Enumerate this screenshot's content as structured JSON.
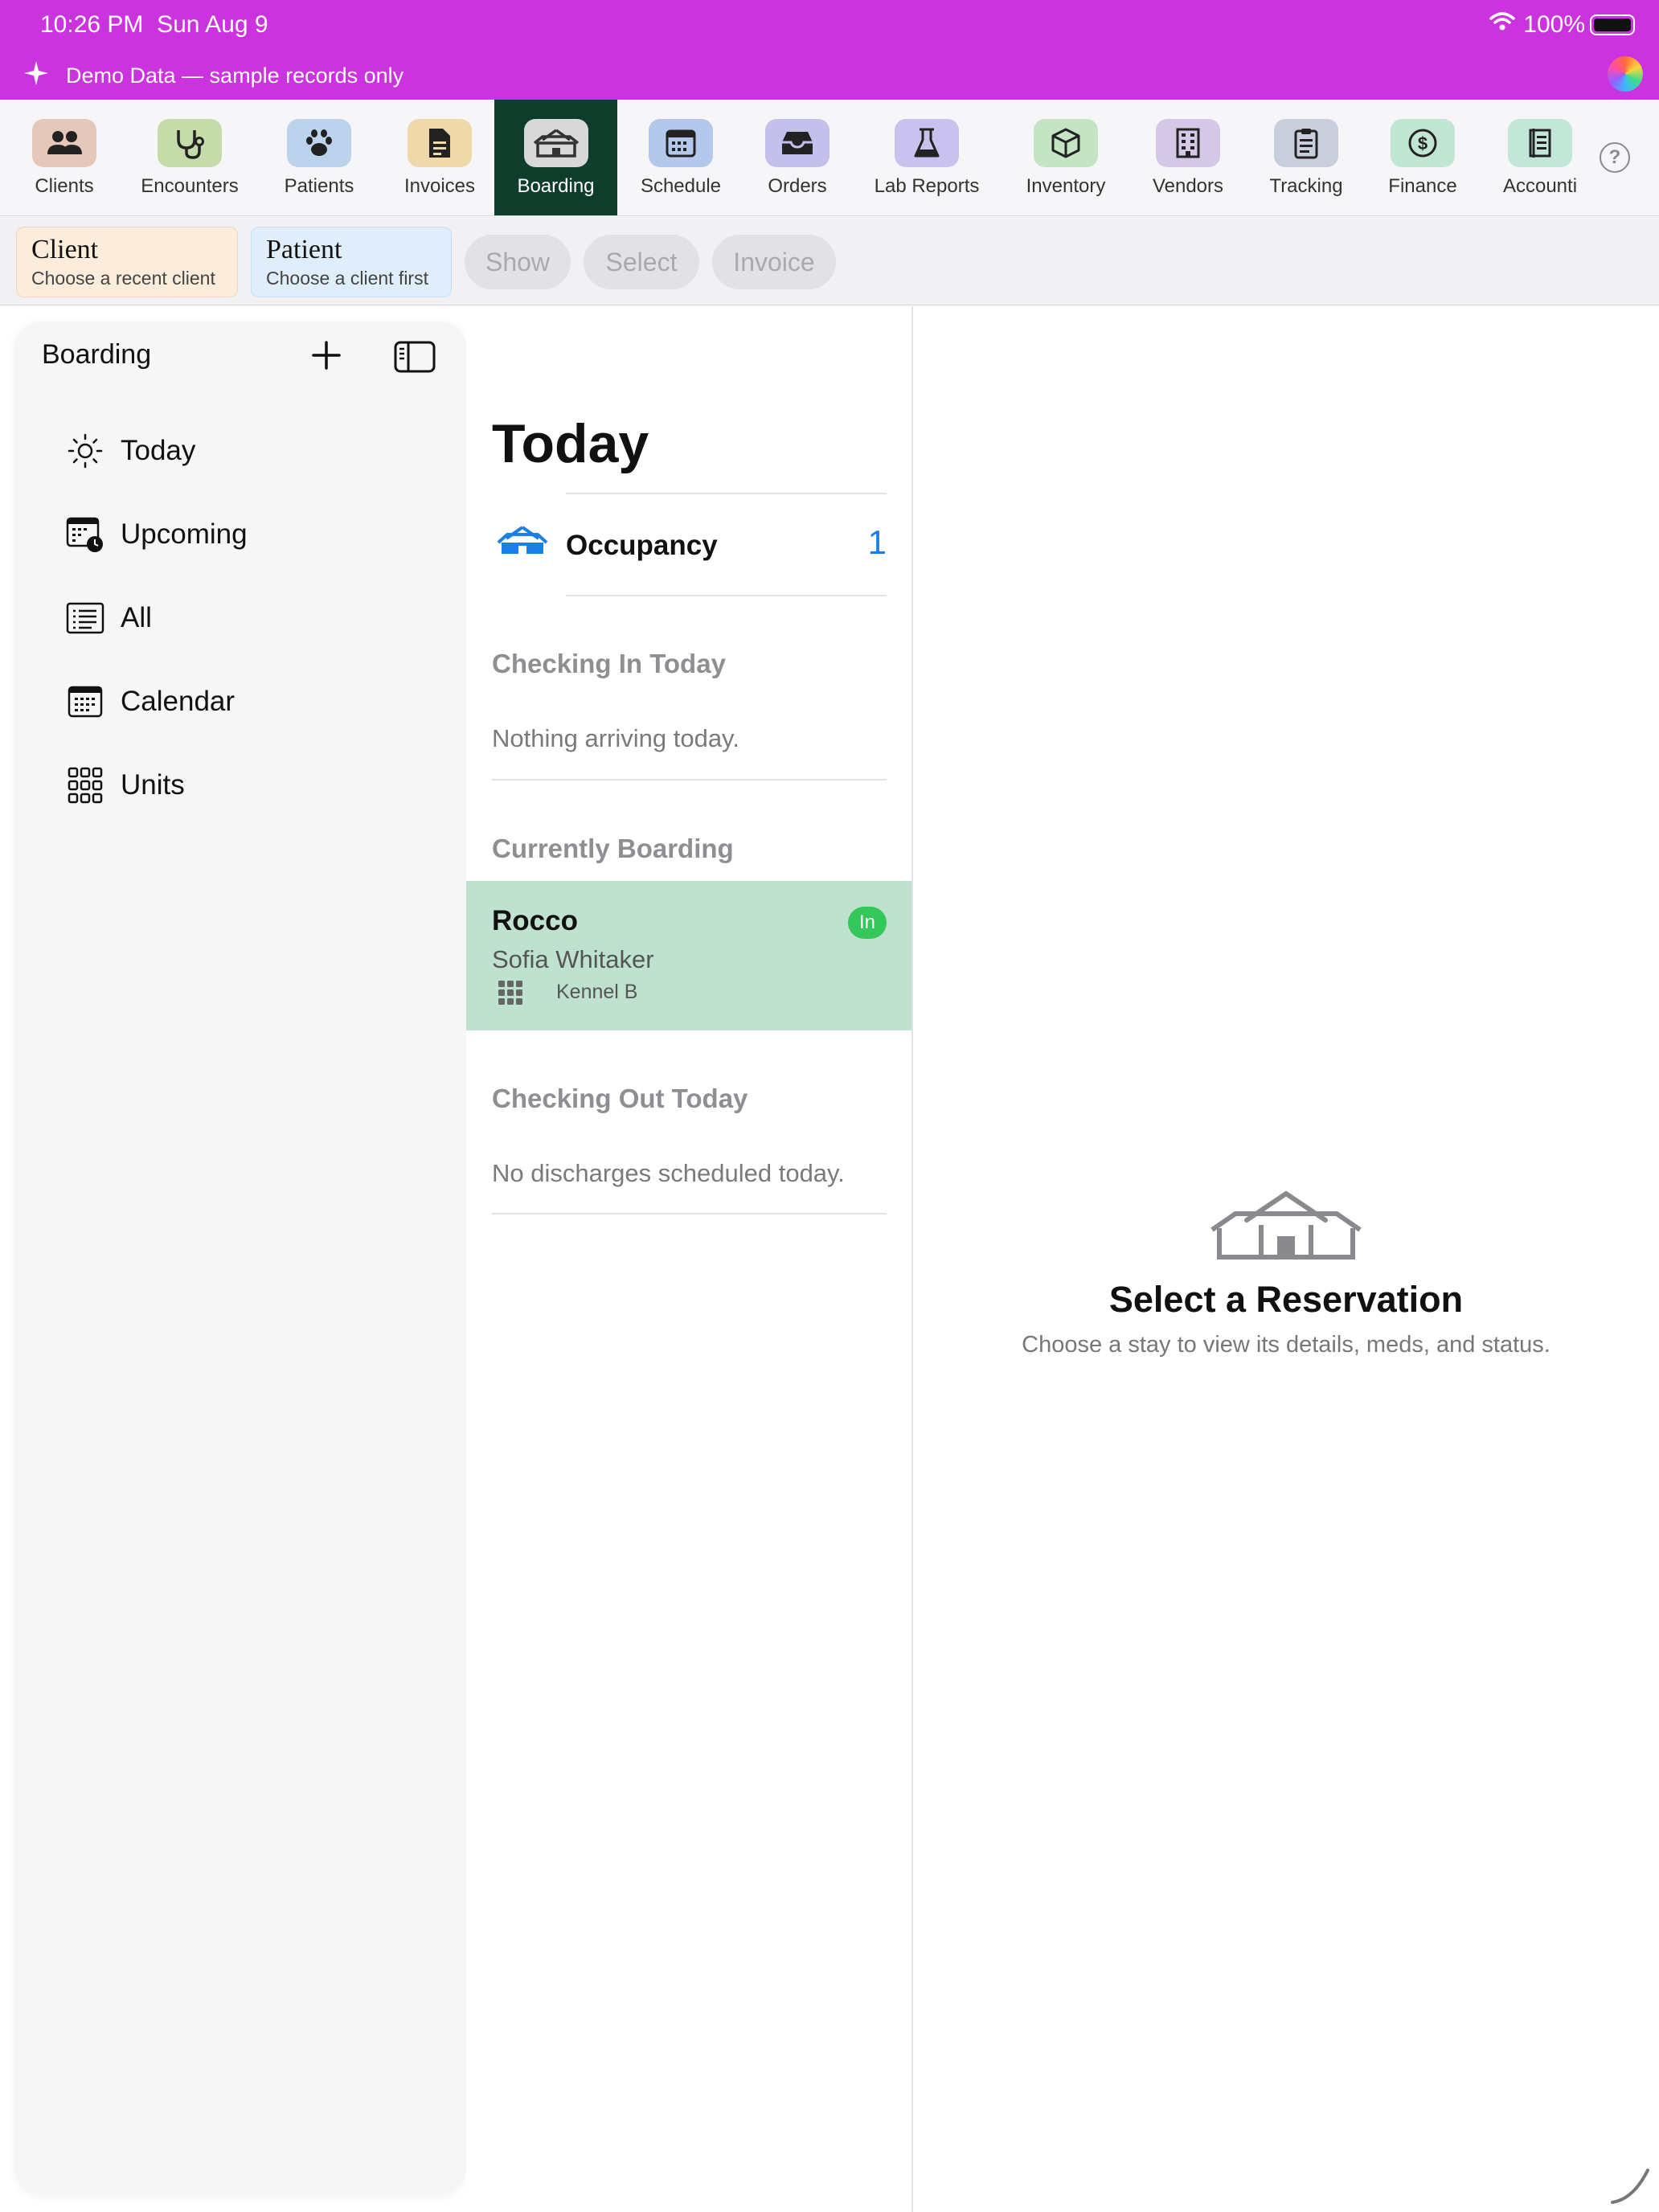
{
  "status_bar": {
    "time": "10:26 PM",
    "date": "Sun Aug 9",
    "battery": "100%",
    "banner": "Demo Data — sample records only",
    "bg_color": "#cb33de"
  },
  "toolbar": {
    "items": [
      {
        "label": "Clients",
        "icon": "people-icon",
        "color": "#e6c8ba"
      },
      {
        "label": "Encounters",
        "icon": "stethoscope-icon",
        "color": "#c5dcaa"
      },
      {
        "label": "Patients",
        "icon": "paw-icon",
        "color": "#bcd3ee"
      },
      {
        "label": "Invoices",
        "icon": "document-icon",
        "color": "#efd9aa"
      },
      {
        "label": "Boarding",
        "icon": "boarding-house-icon",
        "color": "#d8d8d8",
        "active": true
      },
      {
        "label": "Schedule",
        "icon": "calendar-icon",
        "color": "#b4c8ec"
      },
      {
        "label": "Orders",
        "icon": "tray-icon",
        "color": "#c4c0ec"
      },
      {
        "label": "Lab Reports",
        "icon": "flask-icon",
        "color": "#cac2ee"
      },
      {
        "label": "Inventory",
        "icon": "box-icon",
        "color": "#c4e4c4"
      },
      {
        "label": "Vendors",
        "icon": "building-icon",
        "color": "#d4c8e6"
      },
      {
        "label": "Tracking",
        "icon": "clipboard-icon",
        "color": "#c8cedc"
      },
      {
        "label": "Finance",
        "icon": "dollar-icon",
        "color": "#c2e6d4"
      },
      {
        "label": "Accounti",
        "icon": "ledger-icon",
        "color": "#c2e6d8"
      }
    ],
    "active_color": "#0f3d2b",
    "help": "?"
  },
  "context_bar": {
    "client": {
      "title": "Client",
      "subtitle": "Choose a recent client",
      "color": "#fbecdb"
    },
    "patient": {
      "title": "Patient",
      "subtitle": "Choose a client first",
      "color": "#dfeefa"
    },
    "pills": [
      "Show",
      "Select",
      "Invoice"
    ]
  },
  "sidebar": {
    "title": "Boarding",
    "items": [
      {
        "label": "Today",
        "icon": "sun-icon"
      },
      {
        "label": "Upcoming",
        "icon": "calendar-clock-icon"
      },
      {
        "label": "All",
        "icon": "list-icon"
      },
      {
        "label": "Calendar",
        "icon": "calendar-icon"
      },
      {
        "label": "Units",
        "icon": "grid-icon"
      }
    ]
  },
  "list": {
    "title": "Today",
    "occupancy": {
      "label": "Occupancy",
      "count": "1"
    },
    "checking_in": {
      "header": "Checking In Today",
      "empty": "Nothing arriving today."
    },
    "currently_boarding": {
      "header": "Currently Boarding",
      "rows": [
        {
          "name": "Rocco",
          "owner": "Sofia Whitaker",
          "unit": "Kennel B",
          "badge": "In"
        }
      ]
    },
    "checking_out": {
      "header": "Checking Out Today",
      "empty": "No discharges scheduled today."
    },
    "accent": "#1a7fe6",
    "selected_row_color": "#bfe1cf",
    "badge_color": "#34c759"
  },
  "detail": {
    "title": "Select a Reservation",
    "subtitle": "Choose a stay to view its details, meds, and status."
  }
}
